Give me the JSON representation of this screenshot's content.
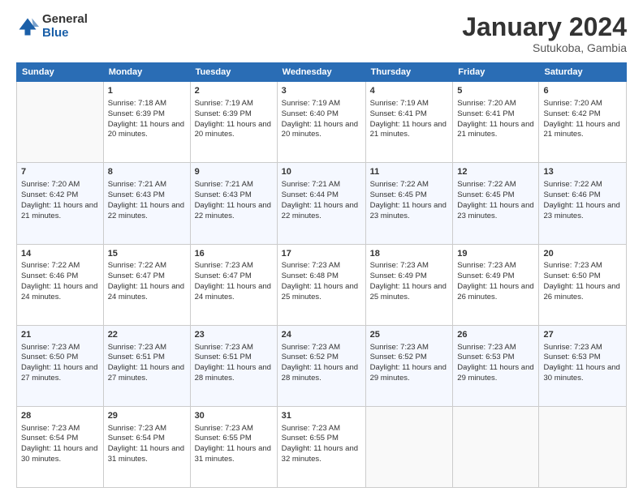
{
  "header": {
    "logo_general": "General",
    "logo_blue": "Blue",
    "month_title": "January 2024",
    "location": "Sutukoba, Gambia"
  },
  "days_of_week": [
    "Sunday",
    "Monday",
    "Tuesday",
    "Wednesday",
    "Thursday",
    "Friday",
    "Saturday"
  ],
  "weeks": [
    [
      {
        "day": "",
        "sunrise": "",
        "sunset": "",
        "daylight": ""
      },
      {
        "day": "1",
        "sunrise": "Sunrise: 7:18 AM",
        "sunset": "Sunset: 6:39 PM",
        "daylight": "Daylight: 11 hours and 20 minutes."
      },
      {
        "day": "2",
        "sunrise": "Sunrise: 7:19 AM",
        "sunset": "Sunset: 6:39 PM",
        "daylight": "Daylight: 11 hours and 20 minutes."
      },
      {
        "day": "3",
        "sunrise": "Sunrise: 7:19 AM",
        "sunset": "Sunset: 6:40 PM",
        "daylight": "Daylight: 11 hours and 20 minutes."
      },
      {
        "day": "4",
        "sunrise": "Sunrise: 7:19 AM",
        "sunset": "Sunset: 6:41 PM",
        "daylight": "Daylight: 11 hours and 21 minutes."
      },
      {
        "day": "5",
        "sunrise": "Sunrise: 7:20 AM",
        "sunset": "Sunset: 6:41 PM",
        "daylight": "Daylight: 11 hours and 21 minutes."
      },
      {
        "day": "6",
        "sunrise": "Sunrise: 7:20 AM",
        "sunset": "Sunset: 6:42 PM",
        "daylight": "Daylight: 11 hours and 21 minutes."
      }
    ],
    [
      {
        "day": "7",
        "sunrise": "Sunrise: 7:20 AM",
        "sunset": "Sunset: 6:42 PM",
        "daylight": "Daylight: 11 hours and 21 minutes."
      },
      {
        "day": "8",
        "sunrise": "Sunrise: 7:21 AM",
        "sunset": "Sunset: 6:43 PM",
        "daylight": "Daylight: 11 hours and 22 minutes."
      },
      {
        "day": "9",
        "sunrise": "Sunrise: 7:21 AM",
        "sunset": "Sunset: 6:43 PM",
        "daylight": "Daylight: 11 hours and 22 minutes."
      },
      {
        "day": "10",
        "sunrise": "Sunrise: 7:21 AM",
        "sunset": "Sunset: 6:44 PM",
        "daylight": "Daylight: 11 hours and 22 minutes."
      },
      {
        "day": "11",
        "sunrise": "Sunrise: 7:22 AM",
        "sunset": "Sunset: 6:45 PM",
        "daylight": "Daylight: 11 hours and 23 minutes."
      },
      {
        "day": "12",
        "sunrise": "Sunrise: 7:22 AM",
        "sunset": "Sunset: 6:45 PM",
        "daylight": "Daylight: 11 hours and 23 minutes."
      },
      {
        "day": "13",
        "sunrise": "Sunrise: 7:22 AM",
        "sunset": "Sunset: 6:46 PM",
        "daylight": "Daylight: 11 hours and 23 minutes."
      }
    ],
    [
      {
        "day": "14",
        "sunrise": "Sunrise: 7:22 AM",
        "sunset": "Sunset: 6:46 PM",
        "daylight": "Daylight: 11 hours and 24 minutes."
      },
      {
        "day": "15",
        "sunrise": "Sunrise: 7:22 AM",
        "sunset": "Sunset: 6:47 PM",
        "daylight": "Daylight: 11 hours and 24 minutes."
      },
      {
        "day": "16",
        "sunrise": "Sunrise: 7:23 AM",
        "sunset": "Sunset: 6:47 PM",
        "daylight": "Daylight: 11 hours and 24 minutes."
      },
      {
        "day": "17",
        "sunrise": "Sunrise: 7:23 AM",
        "sunset": "Sunset: 6:48 PM",
        "daylight": "Daylight: 11 hours and 25 minutes."
      },
      {
        "day": "18",
        "sunrise": "Sunrise: 7:23 AM",
        "sunset": "Sunset: 6:49 PM",
        "daylight": "Daylight: 11 hours and 25 minutes."
      },
      {
        "day": "19",
        "sunrise": "Sunrise: 7:23 AM",
        "sunset": "Sunset: 6:49 PM",
        "daylight": "Daylight: 11 hours and 26 minutes."
      },
      {
        "day": "20",
        "sunrise": "Sunrise: 7:23 AM",
        "sunset": "Sunset: 6:50 PM",
        "daylight": "Daylight: 11 hours and 26 minutes."
      }
    ],
    [
      {
        "day": "21",
        "sunrise": "Sunrise: 7:23 AM",
        "sunset": "Sunset: 6:50 PM",
        "daylight": "Daylight: 11 hours and 27 minutes."
      },
      {
        "day": "22",
        "sunrise": "Sunrise: 7:23 AM",
        "sunset": "Sunset: 6:51 PM",
        "daylight": "Daylight: 11 hours and 27 minutes."
      },
      {
        "day": "23",
        "sunrise": "Sunrise: 7:23 AM",
        "sunset": "Sunset: 6:51 PM",
        "daylight": "Daylight: 11 hours and 28 minutes."
      },
      {
        "day": "24",
        "sunrise": "Sunrise: 7:23 AM",
        "sunset": "Sunset: 6:52 PM",
        "daylight": "Daylight: 11 hours and 28 minutes."
      },
      {
        "day": "25",
        "sunrise": "Sunrise: 7:23 AM",
        "sunset": "Sunset: 6:52 PM",
        "daylight": "Daylight: 11 hours and 29 minutes."
      },
      {
        "day": "26",
        "sunrise": "Sunrise: 7:23 AM",
        "sunset": "Sunset: 6:53 PM",
        "daylight": "Daylight: 11 hours and 29 minutes."
      },
      {
        "day": "27",
        "sunrise": "Sunrise: 7:23 AM",
        "sunset": "Sunset: 6:53 PM",
        "daylight": "Daylight: 11 hours and 30 minutes."
      }
    ],
    [
      {
        "day": "28",
        "sunrise": "Sunrise: 7:23 AM",
        "sunset": "Sunset: 6:54 PM",
        "daylight": "Daylight: 11 hours and 30 minutes."
      },
      {
        "day": "29",
        "sunrise": "Sunrise: 7:23 AM",
        "sunset": "Sunset: 6:54 PM",
        "daylight": "Daylight: 11 hours and 31 minutes."
      },
      {
        "day": "30",
        "sunrise": "Sunrise: 7:23 AM",
        "sunset": "Sunset: 6:55 PM",
        "daylight": "Daylight: 11 hours and 31 minutes."
      },
      {
        "day": "31",
        "sunrise": "Sunrise: 7:23 AM",
        "sunset": "Sunset: 6:55 PM",
        "daylight": "Daylight: 11 hours and 32 minutes."
      },
      {
        "day": "",
        "sunrise": "",
        "sunset": "",
        "daylight": ""
      },
      {
        "day": "",
        "sunrise": "",
        "sunset": "",
        "daylight": ""
      },
      {
        "day": "",
        "sunrise": "",
        "sunset": "",
        "daylight": ""
      }
    ]
  ]
}
